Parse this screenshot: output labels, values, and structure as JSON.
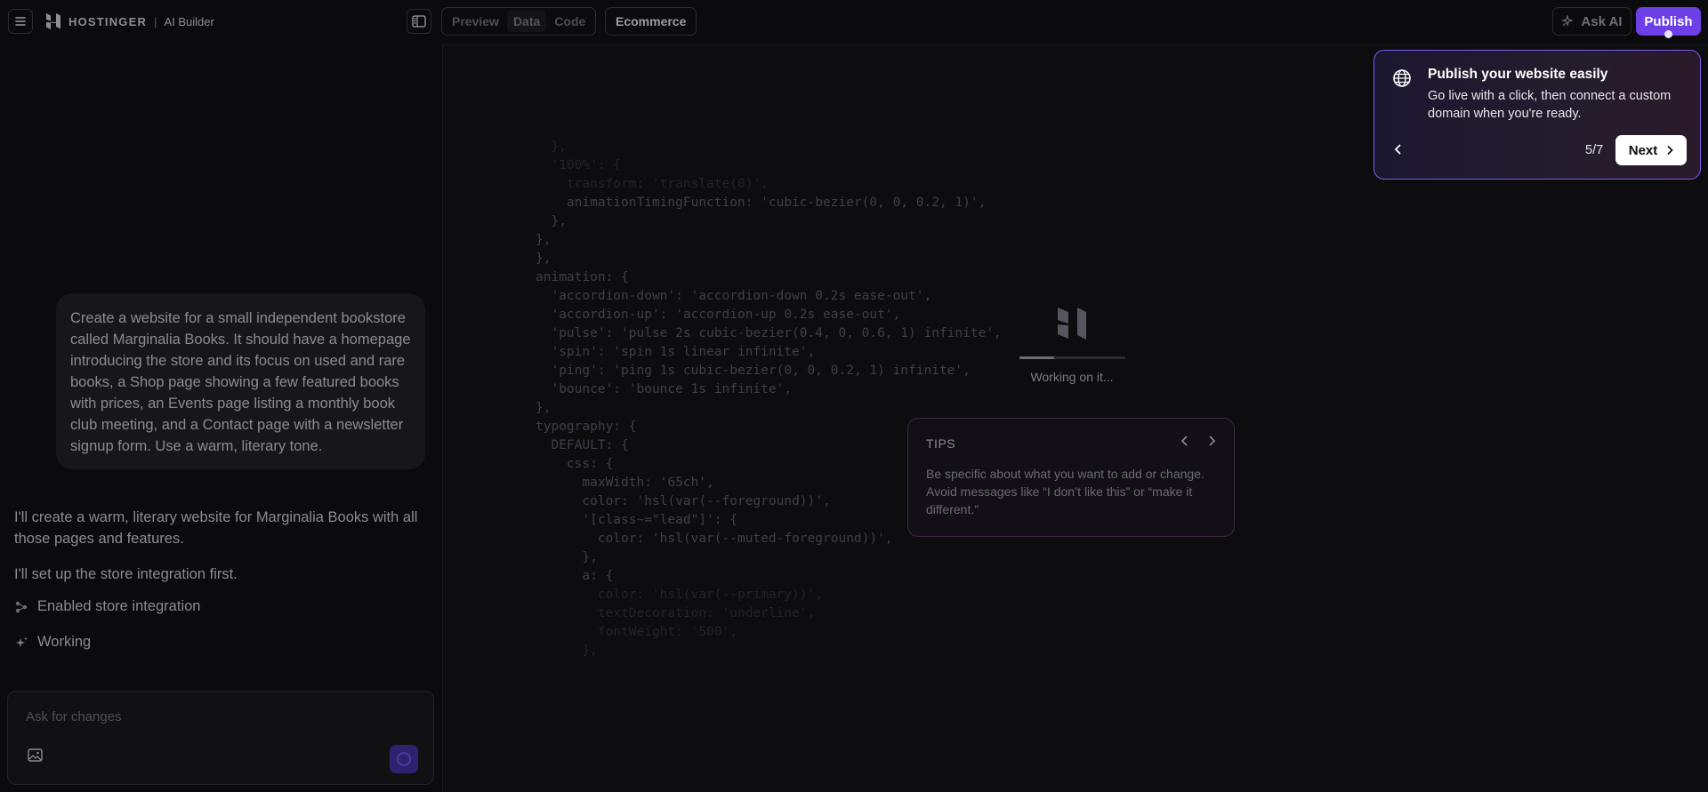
{
  "header": {
    "brand": "HOSTINGER",
    "brand_sep": "|",
    "product": "AI Builder",
    "view_tabs": [
      "Preview",
      "Data",
      "Code"
    ],
    "active_tab": "Data",
    "store_chip": "Ecommerce",
    "ask_ai": "Ask AI",
    "publish": "Publish"
  },
  "chat": {
    "user_message": "Create a website for a small independent bookstore called Marginalia Books. It should have a homepage introducing the store and its focus on used and rare books, a Shop page showing a few featured books with prices, an Events page listing a monthly book club meeting, and a Contact page with a newsletter signup form. Use a warm, literary tone.",
    "ai_reply_1": "I'll create a warm, literary website for Marginalia Books with all those pages and features.",
    "ai_reply_2": "I'll set up the store integration first.",
    "step_1": "Enabled store integration",
    "step_2": "Working"
  },
  "composer": {
    "placeholder": "Ask for changes"
  },
  "code_lines": [
    "  },",
    "  '100%': {",
    "    transform: 'translate(0)',",
    "    animationTimingFunction: 'cubic-bezier(0, 0, 0.2, 1)',",
    "  },",
    "},",
    "},",
    "animation: {",
    "  'accordion-down': 'accordion-down 0.2s ease-out',",
    "  'accordion-up': 'accordion-up 0.2s ease-out',",
    "  'pulse': 'pulse 2s cubic-bezier(0.4, 0, 0.6, 1) infinite',",
    "  'spin': 'spin 1s linear infinite',",
    "  'ping': 'ping 1s cubic-bezier(0, 0, 0.2, 1) infinite',",
    "  'bounce': 'bounce 1s infinite',",
    "},",
    "typography: {",
    "  DEFAULT: {",
    "    css: {",
    "      maxWidth: '65ch',",
    "      color: 'hsl(var(--foreground))',",
    "      '[class~=\"lead\"]': {",
    "        color: 'hsl(var(--muted-foreground))',",
    "      },",
    "      a: {",
    "        color: 'hsl(var(--primary))',",
    "        textDecoration: 'underline',",
    "        fontWeight: '500',",
    "      },"
  ],
  "loader": {
    "text": "Working on it...",
    "progress": 0.33
  },
  "tips": {
    "title": "TIPS",
    "body": "Be specific about what you want to add or change. Avoid messages like “I don’t like this” or “make it different.”"
  },
  "tour": {
    "title": "Publish your website easily",
    "description": "Go live with a click, then connect a custom domain when you're ready.",
    "counter": "5/7",
    "next": "Next"
  },
  "colors": {
    "accent": "#6d3fe6",
    "background": "#0b0b0d"
  }
}
